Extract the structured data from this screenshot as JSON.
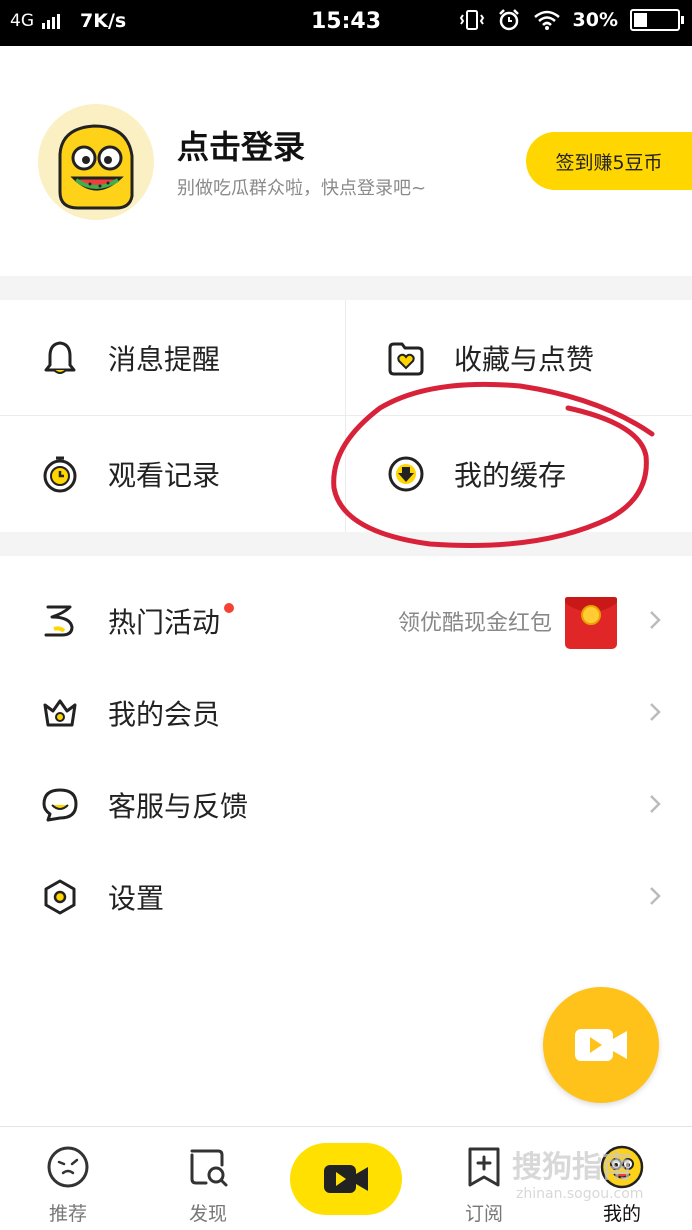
{
  "status_bar": {
    "network": "4G",
    "speed": "7K/s",
    "time": "15:43",
    "battery": "30%",
    "battery_level": 0.3
  },
  "profile": {
    "title": "点击登录",
    "subtitle": "别做吃瓜群众啦，快点登录吧~",
    "checkin_label": "签到赚5豆币"
  },
  "grid": {
    "items": [
      {
        "label": "消息提醒",
        "icon": "bell-icon"
      },
      {
        "label": "收藏与点赞",
        "icon": "favorite-folder-icon"
      },
      {
        "label": "观看记录",
        "icon": "watch-history-icon"
      },
      {
        "label": "我的缓存",
        "icon": "download-icon"
      }
    ]
  },
  "list": {
    "items": [
      {
        "label": "热门活动",
        "icon": "activity-flag-icon",
        "promo": "领优酷现金红包"
      },
      {
        "label": "我的会员",
        "icon": "crown-icon"
      },
      {
        "label": "客服与反馈",
        "icon": "chat-icon"
      },
      {
        "label": "设置",
        "icon": "settings-icon"
      }
    ]
  },
  "bottom_nav": {
    "items": [
      {
        "label": "推荐",
        "icon": "recommend-icon"
      },
      {
        "label": "发现",
        "icon": "discover-icon"
      },
      {
        "label": "",
        "icon": "record-video-icon"
      },
      {
        "label": "订阅",
        "icon": "subscribe-icon"
      },
      {
        "label": "我的",
        "icon": "profile-icon"
      }
    ],
    "active": "我的"
  },
  "watermark": {
    "text": "搜狗指南",
    "sub": "zhinan.sogou.com"
  },
  "colors": {
    "accent_yellow": "#ffd600",
    "fab_yellow": "#ffc21a",
    "annotation_red": "#d8223a",
    "red_dot": "#f44336"
  }
}
